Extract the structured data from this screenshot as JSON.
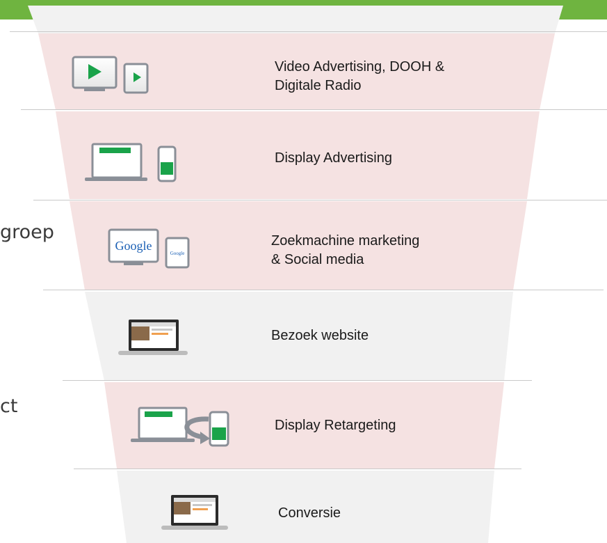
{
  "funnel": {
    "stages": [
      {
        "label": "Video Advertising, DOOH &\nDigitale Radio",
        "shade": "pink",
        "icon": "video-devices-icon"
      },
      {
        "label": "Display Advertising",
        "shade": "pink",
        "icon": "display-devices-icon"
      },
      {
        "label": "Zoekmachine marketing\n& Social media",
        "shade": "pink",
        "icon": "google-devices-icon"
      },
      {
        "label": "Bezoek website",
        "shade": "grey",
        "icon": "website-laptop-icon"
      },
      {
        "label": "Display Retargeting",
        "shade": "pink",
        "icon": "retargeting-devices-icon"
      },
      {
        "label": "Conversie",
        "shade": "grey",
        "icon": "conversion-laptop-icon"
      }
    ],
    "google_text": "Google",
    "side_text": {
      "groep": "groep",
      "ct": "ct"
    }
  },
  "colors": {
    "accent_green": "#6fb440",
    "icon_green": "#1aa34a",
    "pink_band": "#f5e2e2",
    "grey_band": "#f1f1f1"
  }
}
